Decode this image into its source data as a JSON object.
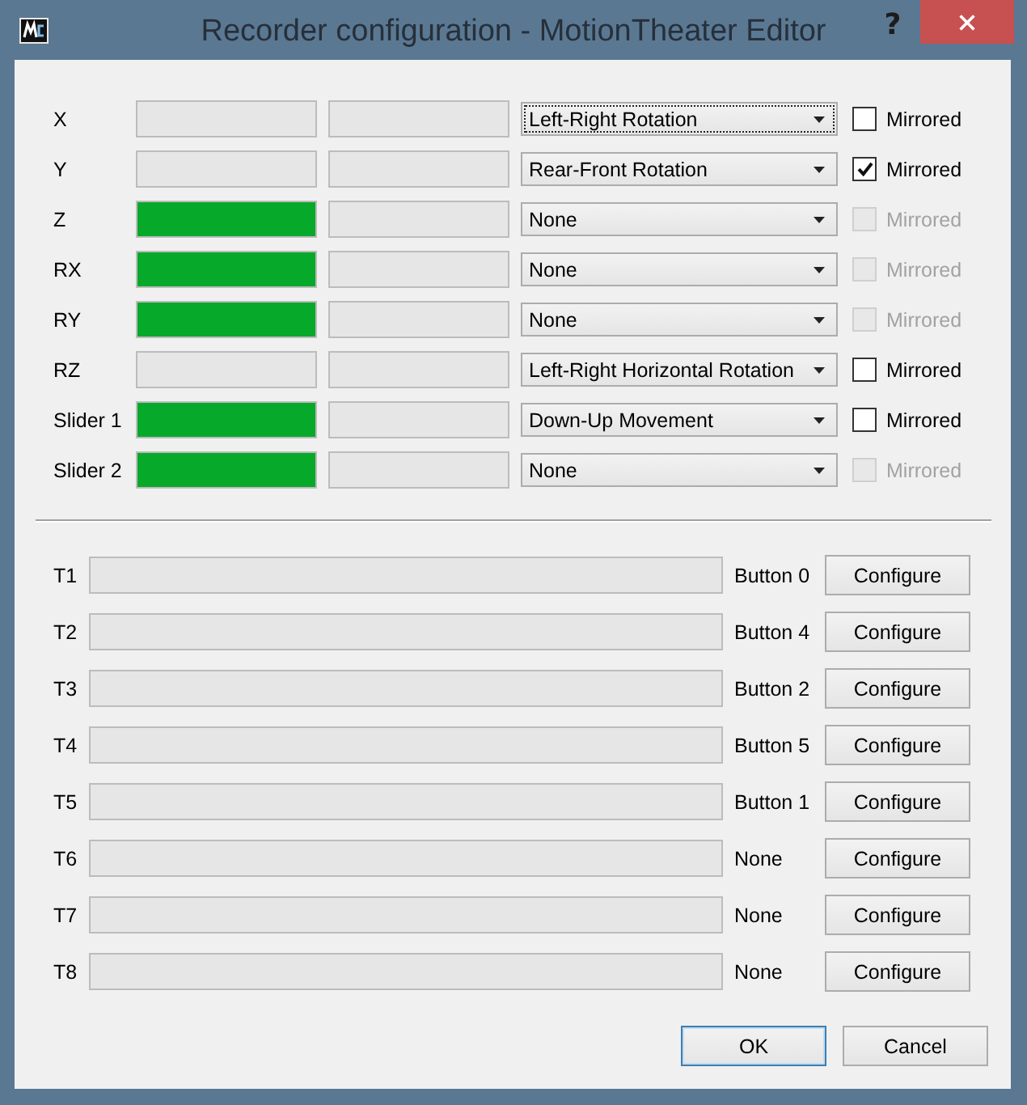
{
  "window": {
    "title": "Recorder configuration - MotionTheater Editor",
    "help": "?"
  },
  "axes": [
    {
      "label": "X",
      "mapping": {
        "value": "Left-Right Rotation",
        "focused": true
      },
      "mirrored": {
        "label": "Mirrored",
        "checked": false,
        "disabled": false
      }
    },
    {
      "label": "Y",
      "mapping": {
        "value": "Rear-Front Rotation",
        "focused": false
      },
      "mirrored": {
        "label": "Mirrored",
        "checked": true,
        "disabled": false
      }
    },
    {
      "label": "Z",
      "level": 1,
      "mapping": {
        "value": "None",
        "focused": false
      },
      "mirrored": {
        "label": "Mirrored",
        "checked": false,
        "disabled": true
      }
    },
    {
      "label": "RX",
      "level": 1,
      "mapping": {
        "value": "None",
        "focused": false
      },
      "mirrored": {
        "label": "Mirrored",
        "checked": false,
        "disabled": true
      }
    },
    {
      "label": "RY",
      "level": 1,
      "mapping": {
        "value": "None",
        "focused": false
      },
      "mirrored": {
        "label": "Mirrored",
        "checked": false,
        "disabled": true
      }
    },
    {
      "label": "RZ",
      "mapping": {
        "value": "Left-Right Horizontal Rotation",
        "focused": false
      },
      "mirrored": {
        "label": "Mirrored",
        "checked": false,
        "disabled": false
      }
    },
    {
      "label": "Slider 1",
      "level": 1,
      "mapping": {
        "value": "Down-Up Movement",
        "focused": false
      },
      "mirrored": {
        "label": "Mirrored",
        "checked": false,
        "disabled": false
      }
    },
    {
      "label": "Slider 2",
      "level": 1,
      "mapping": {
        "value": "None",
        "focused": false
      },
      "mirrored": {
        "label": "Mirrored",
        "checked": false,
        "disabled": true
      }
    }
  ],
  "triggers": [
    {
      "label": "T1",
      "assignment": "Button 0",
      "button": "Configure"
    },
    {
      "label": "T2",
      "assignment": "Button 4",
      "button": "Configure"
    },
    {
      "label": "T3",
      "assignment": "Button 2",
      "button": "Configure"
    },
    {
      "label": "T4",
      "assignment": "Button 5",
      "button": "Configure"
    },
    {
      "label": "T5",
      "assignment": "Button 1",
      "button": "Configure"
    },
    {
      "label": "T6",
      "assignment": "None",
      "button": "Configure"
    },
    {
      "label": "T7",
      "assignment": "None",
      "button": "Configure"
    },
    {
      "label": "T8",
      "assignment": "None",
      "button": "Configure"
    }
  ],
  "buttons": [
    {
      "label": "OK",
      "default": true
    },
    {
      "label": "Cancel",
      "default": false
    }
  ]
}
